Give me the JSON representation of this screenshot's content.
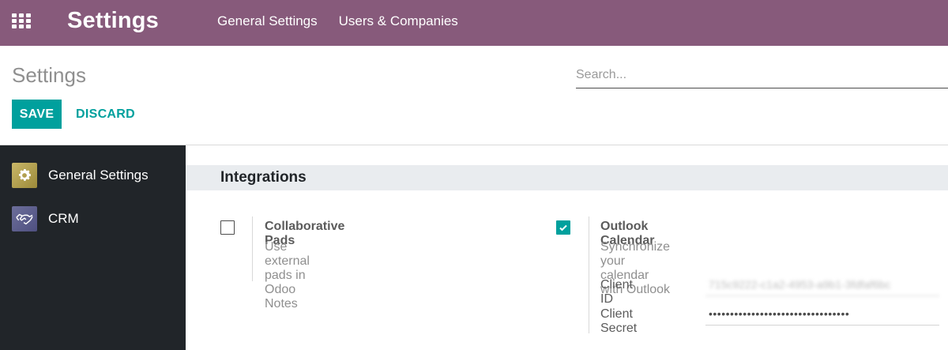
{
  "navbar": {
    "apps_icon": "apps-grid-icon",
    "brand": "Settings",
    "menu": [
      "General Settings",
      "Users & Companies"
    ],
    "background": "#875a7b"
  },
  "control_panel": {
    "title": "Settings",
    "search_placeholder": "Search...",
    "save_label": "SAVE",
    "discard_label": "DISCARD",
    "accent": "#00a09d"
  },
  "sidebar": {
    "items": [
      {
        "label": "General Settings",
        "icon": "gear-icon",
        "selected": true
      },
      {
        "label": "CRM",
        "icon": "handshake-icon",
        "selected": false
      }
    ]
  },
  "main": {
    "section_title": "Integrations",
    "settings": [
      {
        "title": "Collaborative Pads",
        "description": "Use external pads in Odoo Notes",
        "checked": false
      },
      {
        "title": "Outlook Calendar",
        "description": "Synchronize your calendar with Outlook",
        "checked": true,
        "fields": [
          {
            "label": "Client ID",
            "value": "715c9222-c1a2-4953-a9b1-3fdfaf6bc"
          },
          {
            "label": "Client Secret",
            "value": "•••••••••••••••••••••••••••••••••"
          }
        ]
      }
    ]
  }
}
